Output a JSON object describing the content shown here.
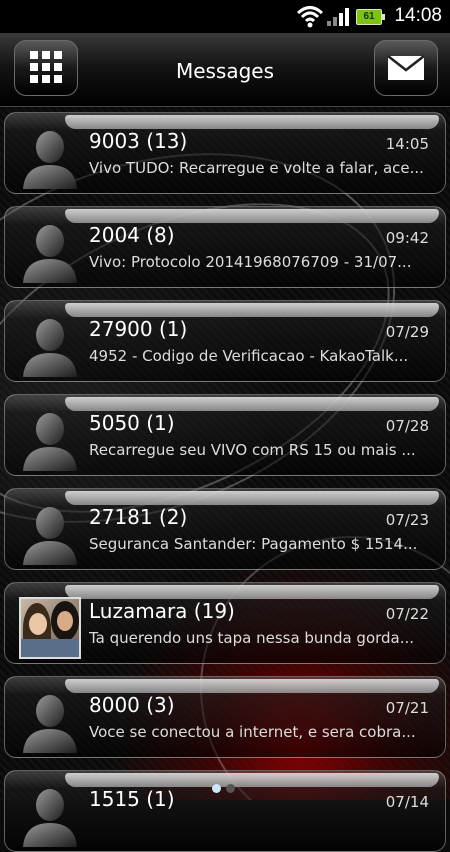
{
  "status": {
    "time": "14:08",
    "battery": "61"
  },
  "header": {
    "title": "Messages"
  },
  "colors": {
    "accent": "#7dc219",
    "background": "#0b0b0b"
  },
  "icons": {
    "left_button": "grid-icon",
    "right_button": "envelope-icon",
    "contact": "person-silhouette-icon"
  },
  "messages": [
    {
      "name": "9003 (13)",
      "date": "14:05",
      "preview": "Vivo TUDO: Recarregue e volte a falar, ace..."
    },
    {
      "name": "2004 (8)",
      "date": "09:42",
      "preview": "Vivo: Protocolo 20141968076709 - 31/07..."
    },
    {
      "name": "27900 (1)",
      "date": "07/29",
      "preview": "4952 - Codigo de Verificacao - KakaoTalk..."
    },
    {
      "name": "5050 (1)",
      "date": "07/28",
      "preview": "Recarregue seu VIVO com RS 15 ou mais ..."
    },
    {
      "name": "27181 (2)",
      "date": "07/23",
      "preview": "Seguranca Santander: Pagamento $ 1514..."
    },
    {
      "name": "Luzamara (19)",
      "date": "07/22",
      "preview": "Ta querendo uns tapa nessa bunda gorda..."
    },
    {
      "name": "8000 (3)",
      "date": "07/21",
      "preview": "Voce se conectou a internet, e sera cobra..."
    },
    {
      "name": "1515 (1)",
      "date": "07/14",
      "preview": ""
    }
  ]
}
